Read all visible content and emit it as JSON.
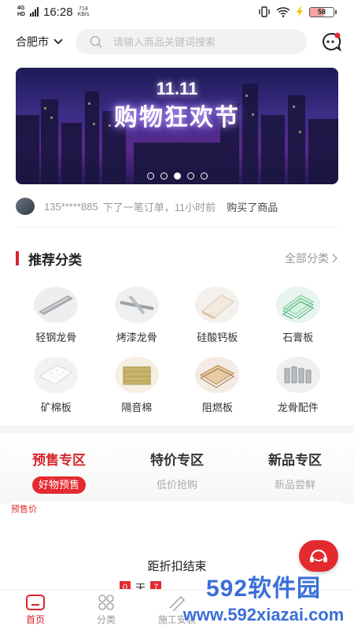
{
  "status_bar": {
    "network": "4G HD",
    "time": "16:28",
    "speed_value": "714",
    "speed_unit": "KB/s",
    "battery": "58"
  },
  "header": {
    "city": "合肥市",
    "search_placeholder": "请输入商品关键词搜索"
  },
  "banner": {
    "headline_top": "11.11",
    "headline": "购物狂欢节",
    "slide_count": 5,
    "active_slide": 3
  },
  "notice": {
    "user": "135*****885",
    "action": "下了一笔订单，11小时前",
    "result": "购买了商品"
  },
  "recommend": {
    "title": "推荐分类",
    "more": "全部分类",
    "items": [
      {
        "label": "轻钢龙骨",
        "icon": "light-steel-keel"
      },
      {
        "label": "烤漆龙骨",
        "icon": "painted-keel"
      },
      {
        "label": "硅酸钙板",
        "icon": "calcium-silicate-board"
      },
      {
        "label": "石膏板",
        "icon": "gypsum-board"
      },
      {
        "label": "矿棉板",
        "icon": "mineral-wool-board"
      },
      {
        "label": "隔音棉",
        "icon": "soundproof-cotton"
      },
      {
        "label": "阻燃板",
        "icon": "flame-retardant-board"
      },
      {
        "label": "龙骨配件",
        "icon": "keel-accessories"
      }
    ]
  },
  "zones": [
    {
      "title": "预售专区",
      "sub": "好物预售",
      "active": true
    },
    {
      "title": "特价专区",
      "sub": "低价抢购",
      "active": false
    },
    {
      "title": "新品专区",
      "sub": "新品尝鲜",
      "active": false
    }
  ],
  "presale": {
    "price_label": "预售价",
    "countdown_title": "距折扣结束",
    "cd_day_value": "0",
    "cd_day_unit": "天",
    "cd_hour_value": "7"
  },
  "bottom_nav": [
    {
      "label": "首页",
      "icon": "home-icon",
      "active": true
    },
    {
      "label": "分类",
      "icon": "category-icon",
      "active": false
    },
    {
      "label": "施工安装",
      "icon": "construction-icon",
      "active": false
    }
  ],
  "watermark": {
    "main": "592软件园",
    "sub": "www.592xiazai.com"
  },
  "colors": {
    "brand_red": "#d7262c",
    "watermark_blue": "#3a6fd8"
  }
}
